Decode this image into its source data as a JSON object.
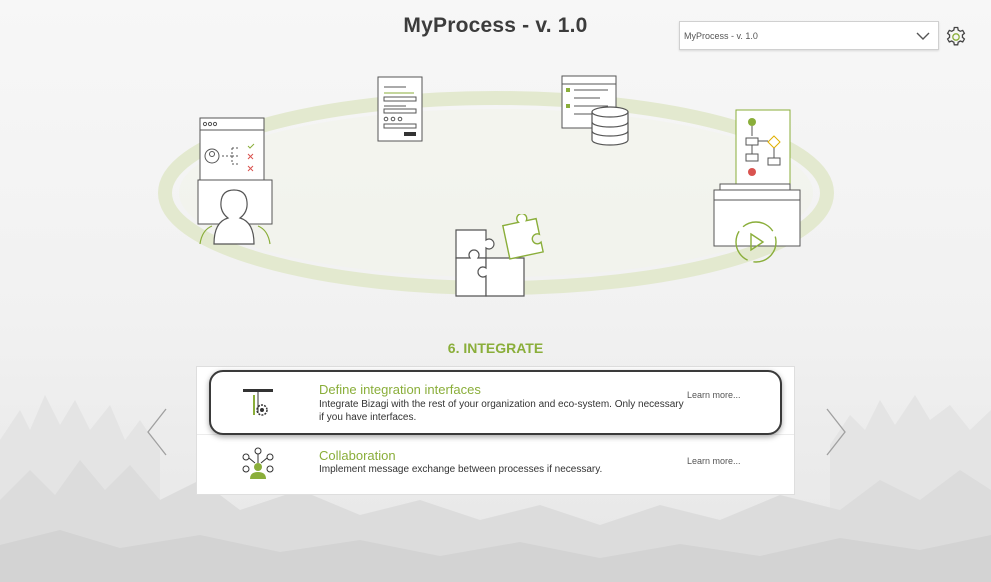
{
  "app": {
    "title": "MyProcess - v. 1.0"
  },
  "version_select": {
    "selected": "MyProcess - v. 1.0",
    "icon": "chevron-down-icon"
  },
  "settings": {
    "icon": "gear-icon"
  },
  "cycle": {
    "stages": [
      {
        "icon": "people-icon"
      },
      {
        "icon": "form-icon"
      },
      {
        "icon": "database-icon"
      },
      {
        "icon": "flowchart-icon"
      },
      {
        "icon": "puzzle-icon"
      }
    ]
  },
  "stage": {
    "title": "6. INTEGRATE"
  },
  "tasks": [
    {
      "name": "Define integration interfaces",
      "description": "Integrate Bizagi with the rest of your organization and eco-system. Only necessary if you have interfaces.",
      "learn_more": "Learn more...",
      "icon": "integration-interface-icon",
      "highlighted": true
    },
    {
      "name": "Collaboration",
      "description": "Implement message exchange between processes if necessary.",
      "learn_more": "Learn more...",
      "icon": "collaboration-icon",
      "highlighted": false
    }
  ],
  "navigation": {
    "prev_icon": "chevron-left-icon",
    "next_icon": "chevron-right-icon"
  },
  "colors": {
    "accent": "#8aae3a",
    "title": "#3c3c3c",
    "icon_outline": "#555555",
    "ellipse": "#e3e9cf"
  }
}
